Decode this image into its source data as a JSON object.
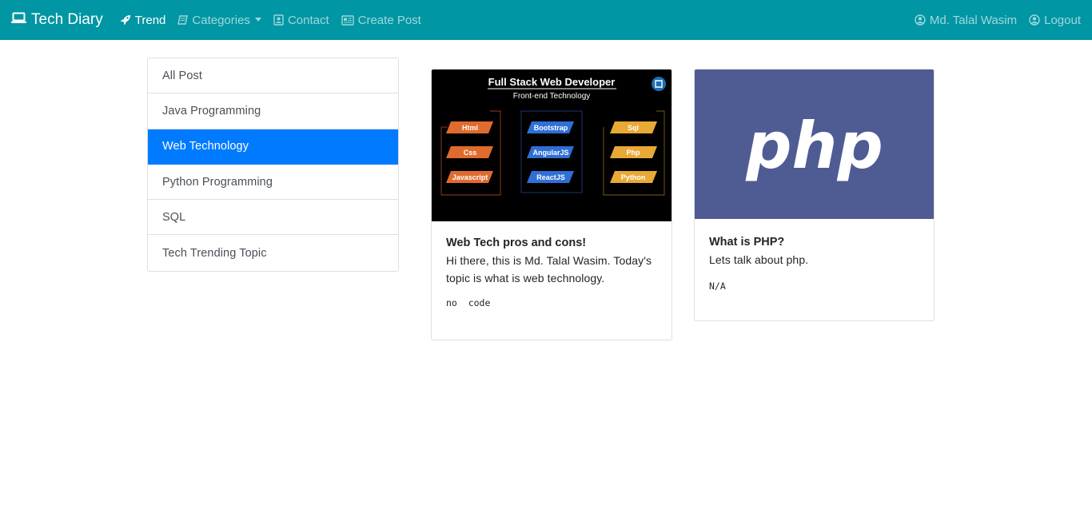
{
  "navbar": {
    "brand": "Tech Diary",
    "brand_icon": "laptop-icon",
    "items": [
      {
        "label": "Trend",
        "icon": "rocket-icon",
        "active": true
      },
      {
        "label": "Categories",
        "icon": "book-icon",
        "dropdown": true
      },
      {
        "label": "Contact",
        "icon": "contact-icon"
      },
      {
        "label": "Create Post",
        "icon": "newspaper-icon"
      }
    ],
    "user_name": "Md. Talal Wasim",
    "logout_label": "Logout",
    "bg_color": "#0096a3"
  },
  "categories": [
    {
      "label": "All Post"
    },
    {
      "label": "Java Programming"
    },
    {
      "label": "Web Technology",
      "active": true
    },
    {
      "label": "Python Programming"
    },
    {
      "label": "SQL"
    },
    {
      "label": "Tech Trending Topic"
    }
  ],
  "active_color": "#007bff",
  "posts": [
    {
      "image": {
        "title": "Full Stack Web Developer",
        "subtitle": "Front-end Technology",
        "col1": [
          "Html",
          "Css",
          "Javascript"
        ],
        "col2": [
          "Bootstrap",
          "AngularJS",
          "ReactJS"
        ],
        "col3": [
          "Sql",
          "Php",
          "Python"
        ]
      },
      "title": "Web Tech pros and cons!",
      "content": "Hi there, this is Md. Talal Wasim. Today's topic is what is web technology.",
      "code": "no  code"
    },
    {
      "image": {
        "logo_text": "php",
        "bg": "#4f5b93"
      },
      "title": "What is PHP?",
      "content": "Lets talk about php.",
      "code": "N/A"
    }
  ]
}
